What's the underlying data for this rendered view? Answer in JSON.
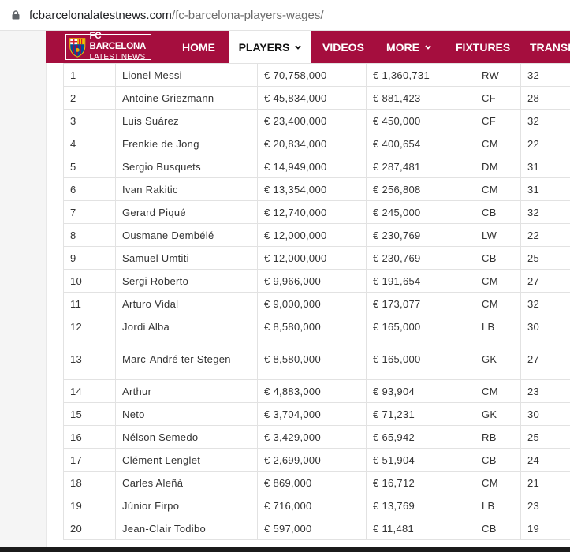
{
  "browser": {
    "url_domain": "fcbarcelonalatestnews.com",
    "url_path": "/fc-barcelona-players-wages/"
  },
  "colors": {
    "nav_bg": "#a50e3e",
    "nav_text": "#ffffff",
    "active_bg": "#ffffff"
  },
  "site": {
    "logo_line1": "FC BARCELONA",
    "logo_line2": "LATEST NEWS"
  },
  "nav": {
    "home": "HOME",
    "players": "PLAYERS",
    "videos": "VIDEOS",
    "more": "MORE",
    "fixtures": "FIXTURES",
    "transfers": "TRANSFERS"
  },
  "table": {
    "rows": [
      [
        "1",
        "Lionel Messi",
        "€ 70,758,000",
        "€ 1,360,731",
        "RW",
        "32"
      ],
      [
        "2",
        "Antoine Griezmann",
        "€ 45,834,000",
        "€ 881,423",
        "CF",
        "28"
      ],
      [
        "3",
        "Luis Suárez",
        "€ 23,400,000",
        "€ 450,000",
        "CF",
        "32"
      ],
      [
        "4",
        "Frenkie de Jong",
        "€ 20,834,000",
        "€ 400,654",
        "CM",
        "22"
      ],
      [
        "5",
        "Sergio Busquets",
        "€ 14,949,000",
        "€ 287,481",
        "DM",
        "31"
      ],
      [
        "6",
        "Ivan Rakitic",
        "€ 13,354,000",
        "€ 256,808",
        "CM",
        "31"
      ],
      [
        "7",
        "Gerard Piqué",
        "€ 12,740,000",
        "€ 245,000",
        "CB",
        "32"
      ],
      [
        "8",
        "Ousmane Dembélé",
        "€ 12,000,000",
        "€ 230,769",
        "LW",
        "22"
      ],
      [
        "9",
        "Samuel Umtiti",
        "€ 12,000,000",
        "€ 230,769",
        "CB",
        "25"
      ],
      [
        "10",
        "Sergi Roberto",
        "€ 9,966,000",
        "€ 191,654",
        "CM",
        "27"
      ],
      [
        "11",
        "Arturo Vidal",
        "€ 9,000,000",
        "€ 173,077",
        "CM",
        "32"
      ],
      [
        "12",
        "Jordi Alba",
        "€ 8,580,000",
        "€ 165,000",
        "LB",
        "30"
      ],
      [
        "13",
        "Marc-André ter Stegen",
        "€ 8,580,000",
        "€ 165,000",
        "GK",
        "27"
      ],
      [
        "14",
        "Arthur",
        "€ 4,883,000",
        "€ 93,904",
        "CM",
        "23"
      ],
      [
        "15",
        "Neto",
        "€ 3,704,000",
        "€ 71,231",
        "GK",
        "30"
      ],
      [
        "16",
        "Nélson Semedo",
        "€ 3,429,000",
        "€ 65,942",
        "RB",
        "25"
      ],
      [
        "17",
        "Clément Lenglet",
        "€ 2,699,000",
        "€ 51,904",
        "CB",
        "24"
      ],
      [
        "18",
        "Carles Aleñà",
        "€ 869,000",
        "€ 16,712",
        "CM",
        "21"
      ],
      [
        "19",
        "Júnior Firpo",
        "€ 716,000",
        "€ 13,769",
        "LB",
        "23"
      ],
      [
        "20",
        "Jean-Clair Todibo",
        "€ 597,000",
        "€ 11,481",
        "CB",
        "19"
      ]
    ]
  }
}
